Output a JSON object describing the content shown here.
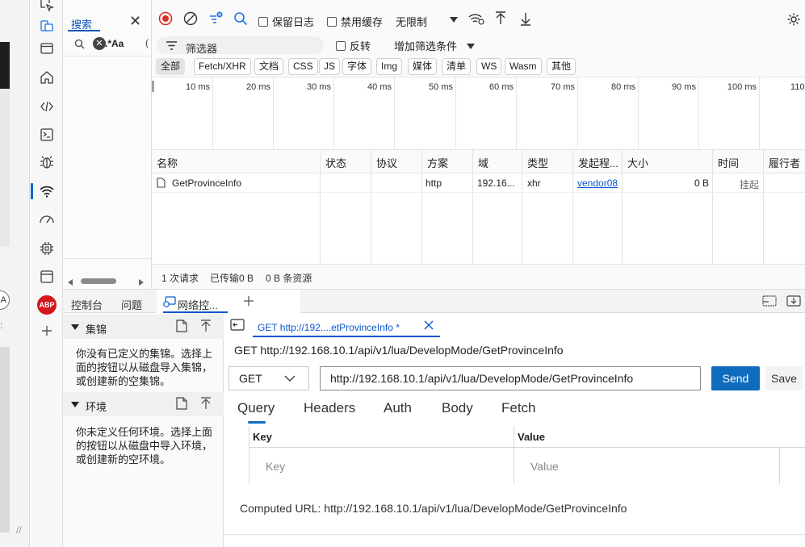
{
  "search_panel": {
    "tab_label": "搜索",
    "options": ".*Aa"
  },
  "toolbar": {
    "preserve_log": "保留日志",
    "disable_cache": "禁用缓存",
    "throttle": "无限制"
  },
  "filter": {
    "placeholder": "筛选器",
    "invert": "反转",
    "more_filters": "增加筛选条件"
  },
  "type_filters": [
    "全部",
    "Fetch/XHR",
    "文档",
    "CSS",
    "JS",
    "字体",
    "Img",
    "媒体",
    "清单",
    "WS",
    "Wasm",
    "其他"
  ],
  "timeline_ticks": [
    "10 ms",
    "20 ms",
    "30 ms",
    "40 ms",
    "50 ms",
    "60 ms",
    "70 ms",
    "80 ms",
    "90 ms",
    "100 ms",
    "110"
  ],
  "table": {
    "headers": [
      "名称",
      "状态",
      "协议",
      "方案",
      "域",
      "类型",
      "发起程...",
      "大小",
      "时间",
      "履行者"
    ],
    "rows": [
      {
        "name": "GetProvinceInfo",
        "status": "",
        "protocol": "",
        "scheme": "http",
        "domain": "192.16...",
        "type": "xhr",
        "initiator": "vendor08",
        "size": "0 B",
        "time": "挂起",
        "fulfilled_by": ""
      }
    ]
  },
  "status_bar": {
    "requests": "1 次请求",
    "transferred": "已传输0 B",
    "resources": "0 B 条资源"
  },
  "drawer": {
    "tabs": [
      "控制台",
      "问题",
      "网络控..."
    ]
  },
  "collections": {
    "title": "集锦",
    "description": "你没有已定义的集锦。选择上面的按钮以从磁盘导入集锦，或创建新的空集锦。"
  },
  "environments": {
    "title": "环境",
    "description": "你未定义任何环境。选择上面的按钮以从磁盘中导入环境，或创建新的空环境。"
  },
  "editor": {
    "file_tab": "GET http://192....etProvinceInfo *",
    "request_title": "GET http://192.168.10.1/api/v1/lua/DevelopMode/GetProvinceInfo",
    "method": "GET",
    "url": "http://192.168.10.1/api/v1/lua/DevelopMode/GetProvinceInfo",
    "send": "Send",
    "save": "Save",
    "tabs": [
      "Query",
      "Headers",
      "Auth",
      "Body",
      "Fetch"
    ],
    "kv_key_header": "Key",
    "kv_value_header": "Value",
    "kv_key_placeholder": "Key",
    "kv_value_placeholder": "Value",
    "computed_url_label": "Computed URL:",
    "computed_url": "http://192.168.10.1/api/v1/lua/DevelopMode/GetProvinceInfo"
  },
  "colors": {
    "accent": "#0f6cbd",
    "record": "#d93025",
    "abp": "#d3181e"
  }
}
